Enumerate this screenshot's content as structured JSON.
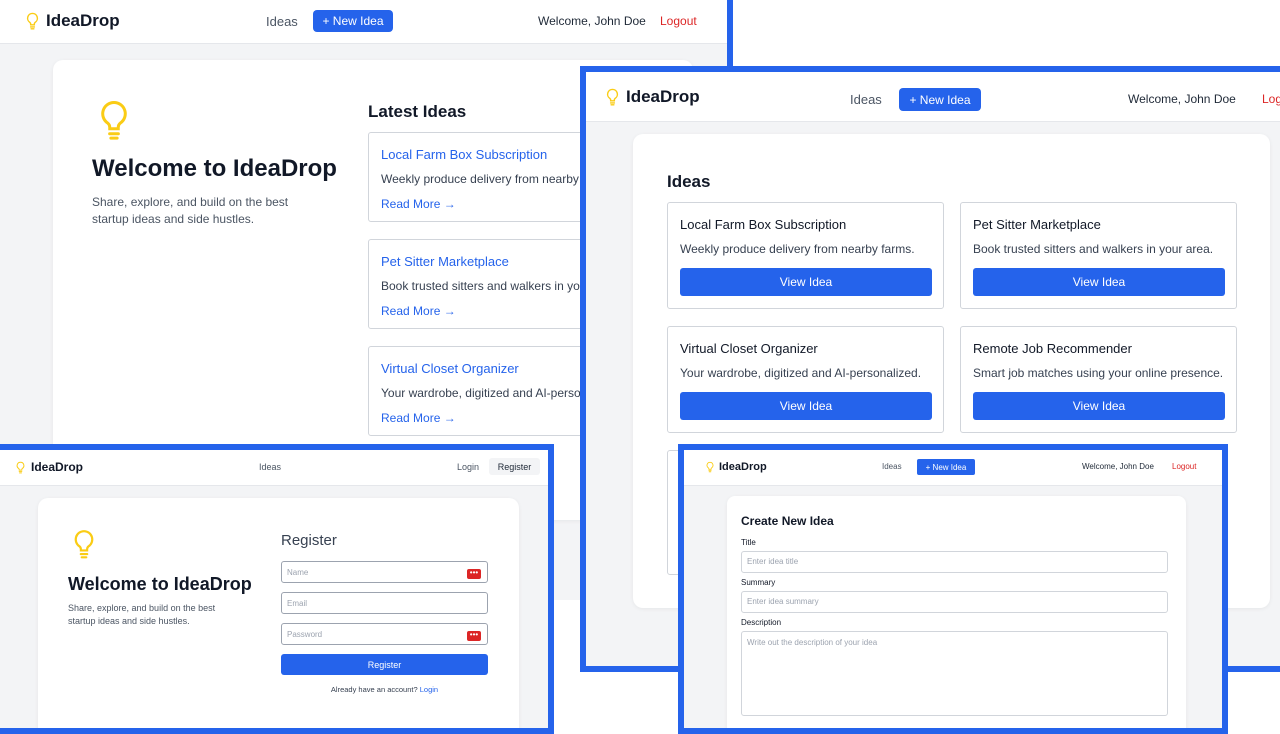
{
  "brand": {
    "name": "IdeaDrop",
    "icon": "lightbulb-icon",
    "icon_color": "#facc15"
  },
  "colors": {
    "accent": "#2563eb",
    "logout": "#dc2626",
    "frame": "#2563eb"
  },
  "nav": {
    "ideas": "Ideas",
    "new_idea": "+ New Idea",
    "welcome": "Welcome, John Doe",
    "logout": "Logout",
    "login": "Login",
    "register": "Register"
  },
  "home": {
    "title": "Welcome to IdeaDrop",
    "subtitle_line1": "Share, explore, and build on the best",
    "subtitle_line2": "startup ideas and side hustles.",
    "latest_heading": "Latest Ideas",
    "read_more": "Read More →",
    "latest": [
      {
        "title": "Local Farm Box Subscription",
        "summary": "Weekly produce delivery from nearby farms."
      },
      {
        "title": "Pet Sitter Marketplace",
        "summary": "Book trusted sitters and walkers in your area."
      },
      {
        "title": "Virtual Closet Organizer",
        "summary": "Your wardrobe, digitized and AI-personalized."
      }
    ]
  },
  "ideas_page": {
    "heading": "Ideas",
    "view_idea": "View Idea",
    "ideas": [
      {
        "title": "Local Farm Box Subscription",
        "summary": "Weekly produce delivery from nearby farms."
      },
      {
        "title": "Pet Sitter Marketplace",
        "summary": "Book trusted sitters and walkers in your area."
      },
      {
        "title": "Virtual Closet Organizer",
        "summary": "Your wardrobe, digitized and AI-personalized."
      },
      {
        "title": "Remote Job Recommender",
        "summary": "Smart job matches using your online presence."
      }
    ]
  },
  "register_page": {
    "heading": "Register",
    "name_placeholder": "Name",
    "email_placeholder": "Email",
    "password_placeholder": "Password",
    "submit": "Register",
    "have_account": "Already have an account?",
    "login_link": "Login"
  },
  "create_page": {
    "heading": "Create New Idea",
    "title_label": "Title",
    "title_placeholder": "Enter idea title",
    "summary_label": "Summary",
    "summary_placeholder": "Enter idea summary",
    "description_label": "Description",
    "description_placeholder": "Write out the description of your idea"
  }
}
